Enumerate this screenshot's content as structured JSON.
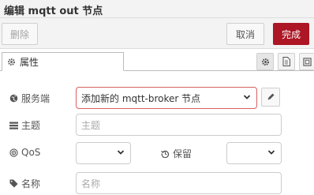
{
  "title": "编辑 mqtt out 节点",
  "toolbar": {
    "delete_label": "删除",
    "cancel_label": "取消",
    "done_label": "完成"
  },
  "tabs": [
    {
      "label": "属性",
      "icon": "gear-icon",
      "active": true
    }
  ],
  "tab_actions": [
    "settings-icon",
    "document-icon",
    "frame-icon"
  ],
  "form": {
    "server": {
      "label": "服务端",
      "icon": "globe-icon",
      "value": "添加新的 mqtt-broker 节点"
    },
    "topic": {
      "label": "主题",
      "icon": "tasks-icon",
      "placeholder": "主题"
    },
    "qos": {
      "label": "QoS",
      "icon": "podcast-icon",
      "value": ""
    },
    "retain": {
      "label": "保留",
      "icon": "history-icon",
      "value": ""
    },
    "name": {
      "label": "名称",
      "icon": "tag-icon",
      "placeholder": "名称"
    }
  },
  "colors": {
    "primary": "#ad1625",
    "error_border": "#d6615f",
    "toolbar_bg": "#f3f3f3"
  }
}
